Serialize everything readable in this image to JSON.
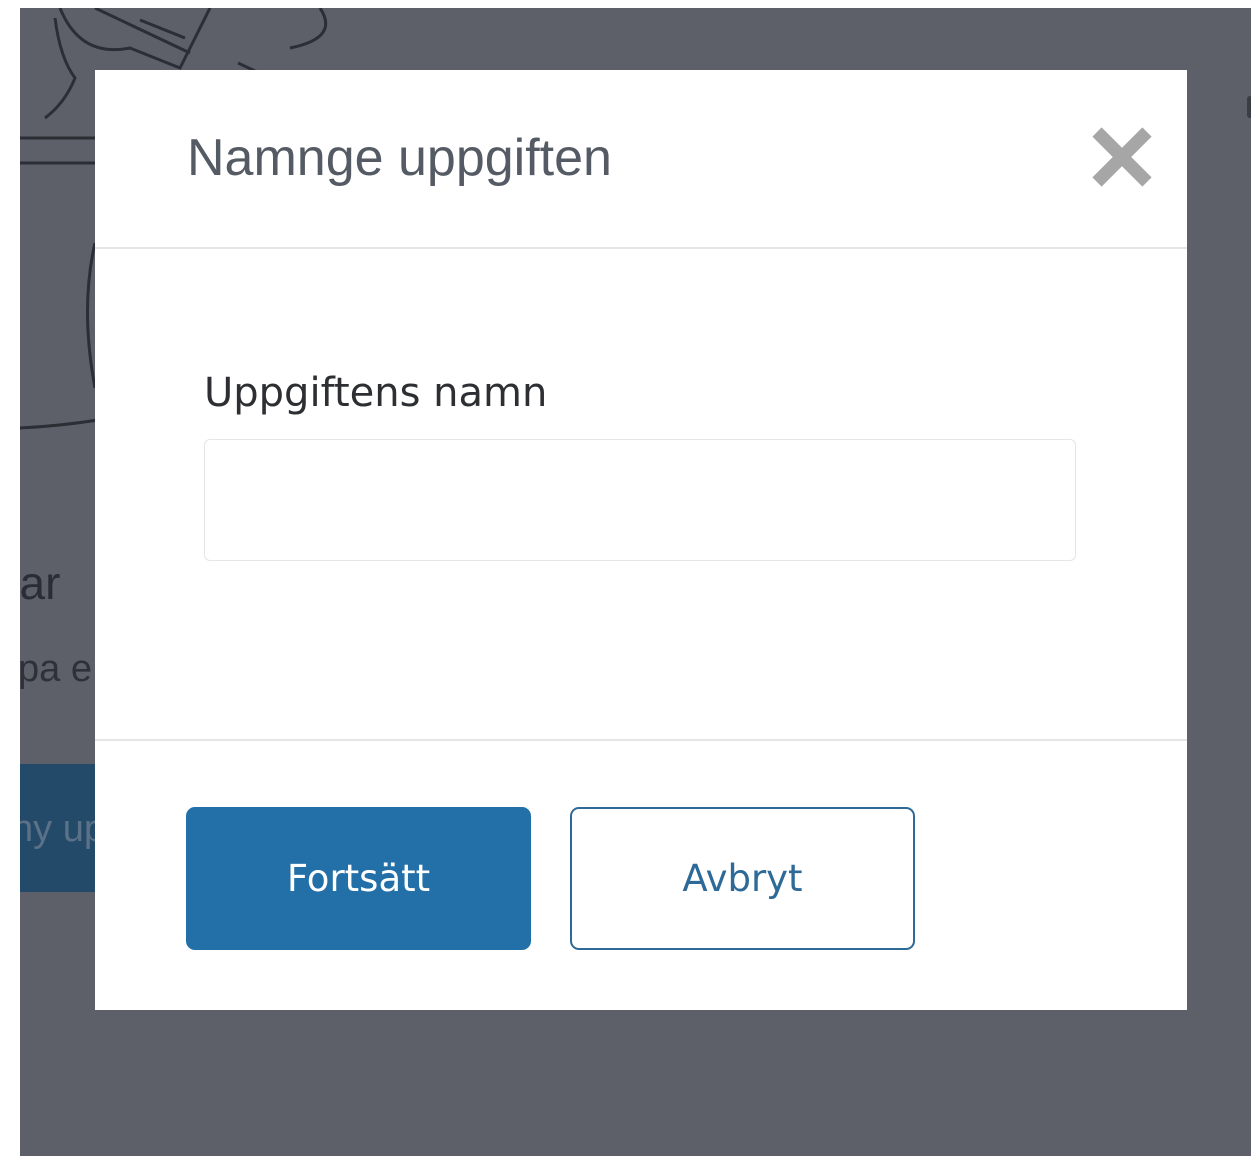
{
  "background": {
    "hero_text_fragment": "tfar",
    "sub_text_fragment": "pa e",
    "button_text_fragment": "ny up"
  },
  "modal": {
    "title": "Namnge uppgiften",
    "close_icon": "close-icon",
    "field": {
      "label": "Uppgiftens namn",
      "value": "",
      "placeholder": ""
    },
    "buttons": {
      "continue_label": "Fortsätt",
      "cancel_label": "Avbryt"
    }
  },
  "colors": {
    "overlay": "#5d6068",
    "primary": "#2370a8",
    "secondary_border": "#2e6a98",
    "title_text": "#555b64",
    "close_icon": "#a6a6a6"
  }
}
